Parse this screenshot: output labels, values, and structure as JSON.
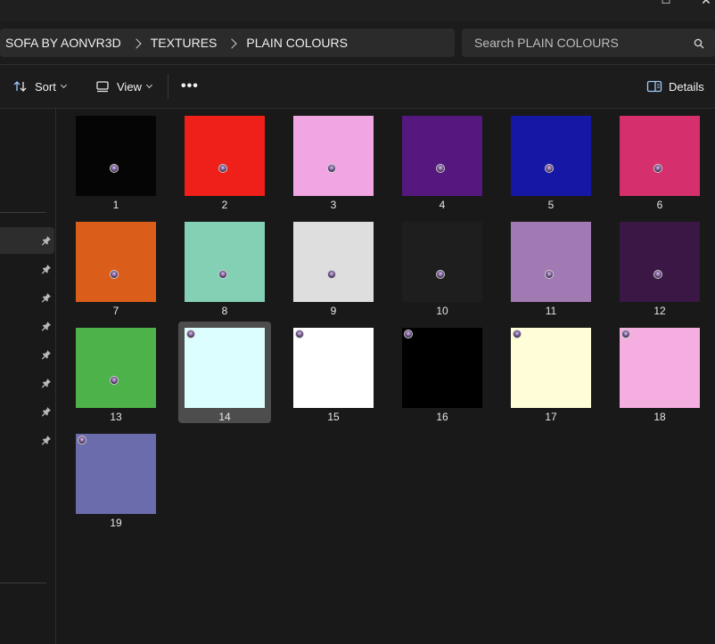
{
  "window": {
    "maximize_glyph": "☐",
    "close_glyph": "✕"
  },
  "breadcrumb": [
    "SOFA BY AONVR3D",
    "TEXTURES",
    "PLAIN COLOURS"
  ],
  "search": {
    "placeholder": "Search PLAIN COLOURS"
  },
  "commandbar": {
    "sort_label": "Sort",
    "view_label": "View",
    "more_label": "•••",
    "details_label": "Details"
  },
  "nav": {
    "pinned_count": 8,
    "selected_index": 0
  },
  "files": [
    {
      "name": "1",
      "color": "#050505",
      "badge": "center"
    },
    {
      "name": "2",
      "color": "#ef2019",
      "badge": "center"
    },
    {
      "name": "3",
      "color": "#f1a5e3",
      "badge": "center"
    },
    {
      "name": "4",
      "color": "#55187f",
      "badge": "center"
    },
    {
      "name": "5",
      "color": "#1717a6",
      "badge": "center"
    },
    {
      "name": "6",
      "color": "#d5306d",
      "badge": "center"
    },
    {
      "name": "7",
      "color": "#db5d1a",
      "badge": "center"
    },
    {
      "name": "8",
      "color": "#84d0b4",
      "badge": "center"
    },
    {
      "name": "9",
      "color": "#dedede",
      "badge": "center"
    },
    {
      "name": "10",
      "color": "#1e1e1e",
      "badge": "center"
    },
    {
      "name": "11",
      "color": "#a27ab3",
      "badge": "center"
    },
    {
      "name": "12",
      "color": "#3a1744",
      "badge": "center"
    },
    {
      "name": "13",
      "color": "#4db24a",
      "badge": "center"
    },
    {
      "name": "14",
      "color": "#dcfefe",
      "badge": "corner",
      "selected": true
    },
    {
      "name": "15",
      "color": "#ffffff",
      "badge": "corner"
    },
    {
      "name": "16",
      "color": "#000000",
      "badge": "corner"
    },
    {
      "name": "17",
      "color": "#fffed8",
      "badge": "corner"
    },
    {
      "name": "18",
      "color": "#f4aedf",
      "badge": "corner"
    },
    {
      "name": "19",
      "color": "#6a6cab",
      "badge": "corner"
    }
  ]
}
